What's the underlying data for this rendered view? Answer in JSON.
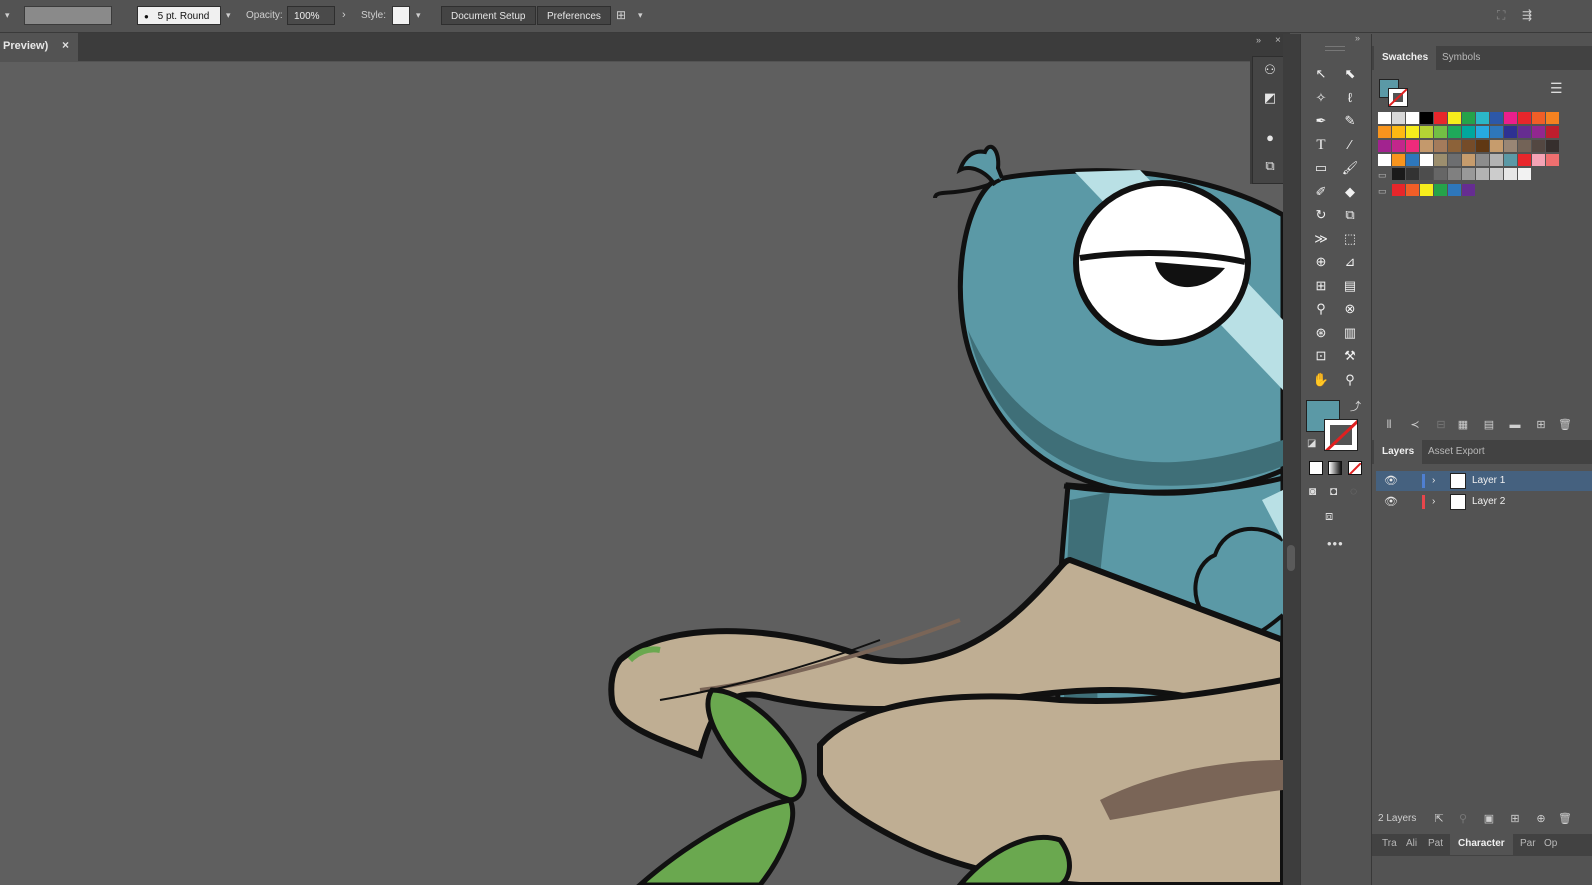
{
  "control_bar": {
    "stroke_profile": "5 pt. Round",
    "opacity_label": "Opacity:",
    "opacity_value": "100%",
    "style_label": "Style:",
    "document_setup_label": "Document Setup",
    "preferences_label": "Preferences"
  },
  "document_tab": {
    "title": "Preview)",
    "close_glyph": "×"
  },
  "swatches_panel": {
    "tabs": [
      "Swatches",
      "Symbols"
    ],
    "fill_color": "#5b99a6",
    "rows": [
      [
        "#ffffff",
        "#d8d8d8",
        "#ffffff",
        "#000000",
        "#e8262b",
        "#f6ed1c",
        "#25a34a",
        "#2bb7c7",
        "#2d58a8",
        "#ec1e8c",
        "#e8262b",
        "#f05e27",
        "#f58220"
      ],
      [
        "#f7941d",
        "#fdb913",
        "#f6ed1c",
        "#b5d334",
        "#72bf44",
        "#1fa95a",
        "#00a79d",
        "#27aae1",
        "#2e77bb",
        "#2e3192",
        "#662d91",
        "#92278f",
        "#be1e2d"
      ],
      [
        "#a2238f",
        "#c2268b",
        "#ee2a7b",
        "#c4996c",
        "#a47b5b",
        "#8c6239",
        "#754c29",
        "#603813",
        "#c69c6d",
        "#998675",
        "#736357",
        "#534741",
        "#362f2d"
      ],
      [
        "#ffffff",
        "#f7941d",
        "#2e77bb",
        "#ffffff",
        "#9c8e6e",
        "#6d6e70",
        "#c69c6d",
        "#8c8c8c",
        "#b3b3b3",
        "#5b99a6",
        "#e8262b",
        "#f4a3b5",
        "#ee6f6f"
      ],
      [
        "#1a1a1a",
        "#333333",
        "#4d4d4d",
        "#666666",
        "#808080",
        "#999999",
        "#b3b3b3",
        "#cccccc",
        "#e6e6e6",
        "#f2f2f2"
      ],
      [
        "#e8262b",
        "#f05e27",
        "#f6ed1c",
        "#25a34a",
        "#2e77bb",
        "#662d91"
      ]
    ]
  },
  "layers_panel": {
    "tabs": [
      "Layers",
      "Asset Export"
    ],
    "layers": [
      {
        "name": "Layer 1",
        "color": "#4f7fd1",
        "selected": true
      },
      {
        "name": "Layer 2",
        "color": "#e8464b",
        "selected": false
      }
    ],
    "count_label": "2 Layers"
  },
  "bottom_tabs": [
    "Tra",
    "Ali",
    "Pat",
    "Character",
    "Par",
    "Op"
  ],
  "toolbar": {
    "fill_color": "#5b99a6",
    "tools": [
      "selection-tool-icon",
      "direct-selection-tool-icon",
      "magic-wand-tool-icon",
      "lasso-tool-icon",
      "pen-tool-icon",
      "curvature-tool-icon",
      "type-tool-icon",
      "line-segment-tool-icon",
      "rectangle-tool-icon",
      "paintbrush-tool-icon",
      "shaper-tool-icon",
      "eraser-tool-icon",
      "rotate-tool-icon",
      "scale-tool-icon",
      "width-tool-icon",
      "free-transform-tool-icon",
      "shape-builder-tool-icon",
      "perspective-grid-tool-icon",
      "mesh-tool-icon",
      "gradient-tool-icon",
      "eyedropper-tool-icon",
      "blend-tool-icon",
      "symbol-sprayer-tool-icon",
      "column-graph-tool-icon",
      "artboard-tool-icon",
      "slice-tool-icon",
      "hand-tool-icon",
      "zoom-tool-icon"
    ]
  }
}
